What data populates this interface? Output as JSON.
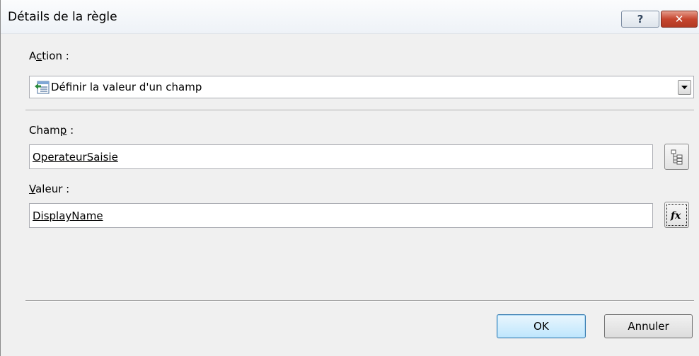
{
  "window": {
    "title": "Détails de la règle",
    "help_label": "?",
    "close_label": "✕"
  },
  "action": {
    "label_pre": "A",
    "label_access": "c",
    "label_post": "tion :",
    "selected": "Définir la valeur d'un champ"
  },
  "champ": {
    "label_pre": "Cham",
    "label_access": "p",
    "label_post": " :",
    "value": "OperateurSaisie"
  },
  "valeur": {
    "label_access": "V",
    "label_post": "aleur :",
    "value": "DisplayName"
  },
  "buttons": {
    "ok": "OK",
    "cancel": "Annuler"
  },
  "colors": {
    "close_button": "#c6462f",
    "ok_border": "#3c7fb1"
  }
}
